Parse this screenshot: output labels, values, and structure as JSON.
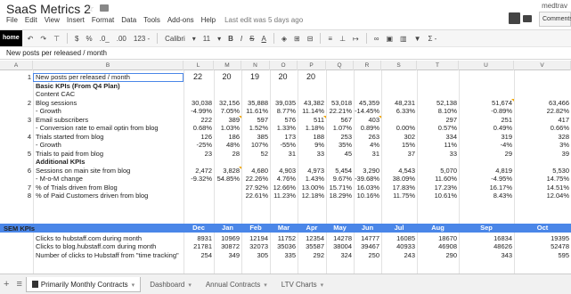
{
  "doc": {
    "title": "SaaS Metrics 2",
    "user": "medtrav"
  },
  "menu": [
    "File",
    "Edit",
    "View",
    "Insert",
    "Format",
    "Data",
    "Tools",
    "Add-ons",
    "Help"
  ],
  "last_edit": "Last edit was 5 days ago",
  "comments_label": "Comments",
  "toolbar": {
    "home": "home",
    "dollar": "$",
    "percent": "%",
    "dec1": ".0_",
    "dec2": ".00",
    "numfmt": "123 -",
    "font": "Calibri",
    "size": "11",
    "bold": "B",
    "italic": "I",
    "strike": "S",
    "color": "A",
    "sum": "Σ -"
  },
  "formula": "New posts per released / month",
  "columns": [
    "A",
    "B",
    "L",
    "M",
    "N",
    "O",
    "P",
    "Q",
    "R",
    "S",
    "T",
    "U",
    "V"
  ],
  "rows": [
    {
      "n": "1",
      "label": "New posts per released / month",
      "bold": false,
      "v": [
        "22",
        "20",
        "19",
        "20",
        "20",
        "",
        "",
        "",
        "",
        "",
        ""
      ]
    },
    {
      "n": "",
      "label": "Basic KPIs (From Q4 Plan)",
      "bold": true,
      "v": [
        "",
        "",
        "",
        "",
        "",
        "",
        "",
        "",
        "",
        "",
        ""
      ]
    },
    {
      "n": "",
      "label": "Content CAC",
      "bold": false,
      "v": [
        "",
        "",
        "",
        "",
        "",
        "",
        "",
        "",
        "",
        "",
        ""
      ]
    },
    {
      "n": "2",
      "label": "Blog sessions",
      "bold": false,
      "v": [
        "30,038",
        "32,156",
        "35,888",
        "39,035",
        "43,382",
        "53,018",
        "45,359",
        "48,231",
        "52,138",
        "51,674",
        "63,466"
      ]
    },
    {
      "n": "",
      "label": "- Growth",
      "bold": false,
      "v": [
        "-4.99%",
        "7.05%",
        "11.61%",
        "8.77%",
        "11.14%",
        "22.21%",
        "-14.45%",
        "6.33%",
        "8.10%",
        "-0.89%",
        "22.82%"
      ]
    },
    {
      "n": "3",
      "label": "Email subscribers",
      "bold": false,
      "v": [
        "222",
        "389",
        "597",
        "576",
        "511",
        "567",
        "403",
        "",
        "297",
        "251",
        "417"
      ]
    },
    {
      "n": "",
      "label": "- Conversion rate to email optin from blog",
      "bold": false,
      "v": [
        "0.68%",
        "1.03%",
        "1.52%",
        "1.33%",
        "1.18%",
        "1.07%",
        "0.89%",
        "0.00%",
        "0.57%",
        "0.49%",
        "0.66%"
      ]
    },
    {
      "n": "4",
      "label": "Trials started from blog",
      "bold": false,
      "v": [
        "126",
        "186",
        "385",
        "173",
        "188",
        "253",
        "263",
        "302",
        "334",
        "319",
        "328"
      ]
    },
    {
      "n": "",
      "label": "- Growth",
      "bold": false,
      "v": [
        "-25%",
        "48%",
        "107%",
        "-55%",
        "9%",
        "35%",
        "4%",
        "15%",
        "11%",
        "-4%",
        "3%"
      ]
    },
    {
      "n": "5",
      "label": "Trials to paid from blog",
      "bold": false,
      "v": [
        "23",
        "28",
        "52",
        "31",
        "33",
        "45",
        "31",
        "37",
        "33",
        "29",
        "39"
      ]
    },
    {
      "n": "",
      "label": "Additional KPIs",
      "bold": true,
      "v": [
        "",
        "",
        "",
        "",
        "",
        "",
        "",
        "",
        "",
        "",
        ""
      ]
    },
    {
      "n": "6",
      "label": "Sessions on main site from blog",
      "bold": false,
      "v": [
        "2,472",
        "3,828",
        "4,680",
        "4,903",
        "4,973",
        "5,454",
        "3,290",
        "4,543",
        "5,070",
        "4,819",
        "5,530"
      ]
    },
    {
      "n": "",
      "label": "- M-o-M change",
      "bold": false,
      "v": [
        "-9.32%",
        "54.85%",
        "22.26%",
        "4.76%",
        "1.43%",
        "9.67%",
        "-39.68%",
        "38.09%",
        "11.60%",
        "-4.95%",
        "14.75%"
      ]
    },
    {
      "n": "7",
      "label": "% of Trials driven from Blog",
      "bold": false,
      "v": [
        "",
        "",
        "27.92%",
        "12.66%",
        "13.00%",
        "15.71%",
        "16.03%",
        "17.83%",
        "17.23%",
        "16.17%",
        "14.51%"
      ]
    },
    {
      "n": "8",
      "label": "% of Paid Customers driven from blog",
      "bold": false,
      "v": [
        "",
        "",
        "22.61%",
        "11.23%",
        "12.18%",
        "18.29%",
        "10.16%",
        "11.75%",
        "10.61%",
        "8.43%",
        "12.04%"
      ]
    }
  ],
  "sem": {
    "label": "SEM KPIs",
    "months": [
      "Dec",
      "Jan",
      "Feb",
      "Mar",
      "Apr",
      "May",
      "Jun",
      "Jul",
      "Aug",
      "Sep",
      "Oct"
    ],
    "rows": [
      {
        "label": "Clicks to hubstaff.com during month",
        "v": [
          "8931",
          "10969",
          "12194",
          "11752",
          "12354",
          "14278",
          "14777",
          "16085",
          "18670",
          "16834",
          "19395"
        ]
      },
      {
        "label": "Clicks to blog.hubstaff.com during month",
        "v": [
          "21781",
          "30872",
          "32073",
          "35036",
          "35587",
          "38004",
          "39467",
          "40933",
          "46908",
          "48626",
          "52478"
        ]
      },
      {
        "label": "Number of clicks to Hubstaff from \"time tracking\"",
        "v": [
          "254",
          "349",
          "305",
          "335",
          "292",
          "324",
          "250",
          "243",
          "290",
          "343",
          "595"
        ]
      }
    ]
  },
  "tabs": [
    {
      "label": "Primarily Monthly Contracts",
      "active": true
    },
    {
      "label": "Dashboard",
      "active": false
    },
    {
      "label": "Annual Contracts",
      "active": false
    },
    {
      "label": "LTV Charts",
      "active": false
    }
  ]
}
